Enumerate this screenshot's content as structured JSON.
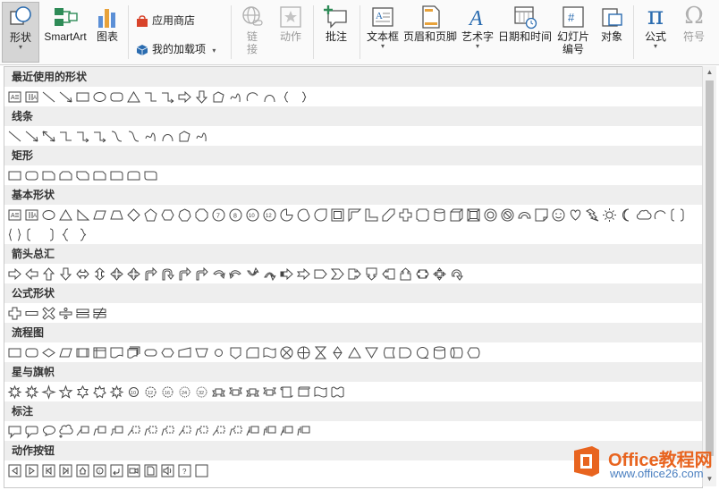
{
  "ribbon": {
    "shapes": "形状",
    "smartart": "SmartArt",
    "chart": "图表",
    "store": "应用商店",
    "addins": "我的加载项",
    "link": "链\n接",
    "link1": "链",
    "link2": "接",
    "action": "动作",
    "comment": "批注",
    "textbox": "文本框",
    "header_footer": "页眉和页脚",
    "wordart": "艺术字",
    "datetime": "日期和时间",
    "slide_number1": "幻灯片",
    "slide_number2": "编号",
    "object": "对象",
    "equation": "公式",
    "symbol": "符号",
    "pi": "π",
    "omega": "Ω"
  },
  "sections": [
    {
      "title": "最近使用的形状"
    },
    {
      "title": "线条"
    },
    {
      "title": "矩形"
    },
    {
      "title": "基本形状"
    },
    {
      "title": "箭头总汇"
    },
    {
      "title": "公式形状"
    },
    {
      "title": "流程图"
    },
    {
      "title": "星与旗帜"
    },
    {
      "title": "标注"
    },
    {
      "title": "动作按钮"
    }
  ],
  "watermark": {
    "brand": "Office教程网",
    "url": "www.office26.com"
  },
  "colors": {
    "accent_blue": "#2b6cb0",
    "office_orange": "#e8641f",
    "ribbon_active": "#d5d5d5",
    "section_header": "#eeeeee"
  }
}
